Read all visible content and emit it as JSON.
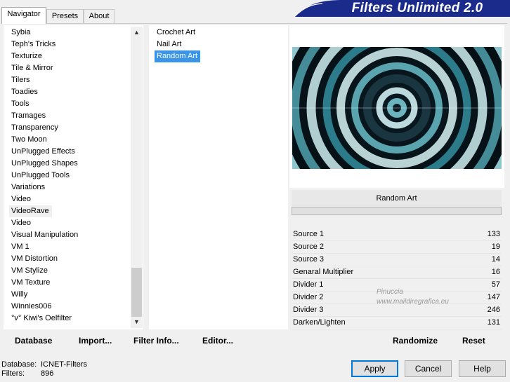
{
  "tabs": [
    {
      "label": "Navigator"
    },
    {
      "label": "Presets"
    },
    {
      "label": "About"
    }
  ],
  "banner_title": "Filters Unlimited 2.0",
  "categories": [
    "Sybia",
    "Teph's Tricks",
    "Texturize",
    "Tile & Mirror",
    "Tilers",
    "Toadies",
    "Tools",
    "Tramages",
    "Transparency",
    "Two Moon",
    "UnPlugged Effects",
    "UnPlugged Shapes",
    "UnPlugged Tools",
    "Variations",
    "Video",
    "VideoRave",
    "Video",
    "Visual Manipulation",
    "VM 1",
    "VM Distortion",
    "VM Stylize",
    "VM Texture",
    "Willy",
    "Winnies006",
    "°v° Kiwi's Oelfilter"
  ],
  "highlighted_category": "VideoRave",
  "filters": [
    "Crochet Art",
    "Nail Art",
    "Random Art"
  ],
  "selected_filter": "Random Art",
  "toolbar": {
    "database": "Database",
    "import": "Import...",
    "filter_info": "Filter Info...",
    "editor": "Editor...",
    "randomize": "Randomize",
    "reset": "Reset"
  },
  "current_filter_name": "Random Art",
  "parameters": [
    {
      "name": "Source 1",
      "value": "133"
    },
    {
      "name": "Source 2",
      "value": "19"
    },
    {
      "name": "Source 3",
      "value": "14"
    },
    {
      "name": "Genaral Multiplier",
      "value": "16"
    },
    {
      "name": "Divider 1",
      "value": "57"
    },
    {
      "name": "Divider 2",
      "value": "147"
    },
    {
      "name": "Divider 3",
      "value": "246"
    },
    {
      "name": "Darken/Lighten",
      "value": "131"
    }
  ],
  "status": {
    "database_label": "Database:",
    "database_value": "ICNET-Filters",
    "filters_label": "Filters:",
    "filters_value": "896"
  },
  "buttons": {
    "apply": "Apply",
    "cancel": "Cancel",
    "help": "Help"
  },
  "watermark": {
    "line1": "Pinuccia",
    "line2": "www.maildiregrafica.eu"
  },
  "colors": {
    "banner": "#1a2b8c",
    "selection": "#3a94e8",
    "default_border": "#0078d7"
  }
}
